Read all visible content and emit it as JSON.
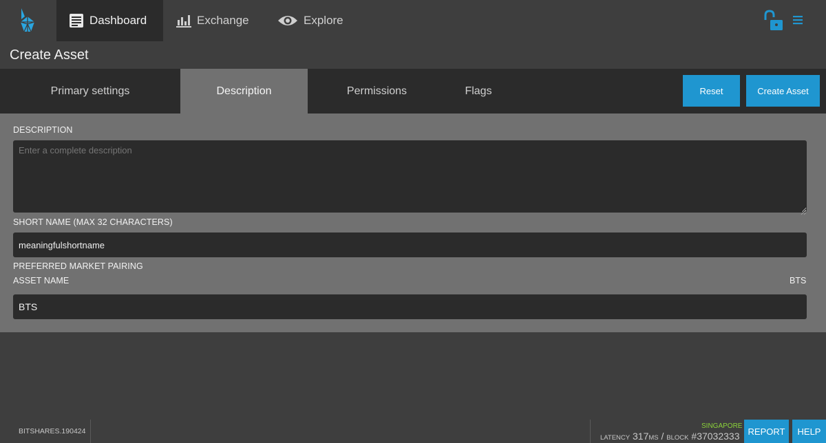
{
  "nav": {
    "items": [
      {
        "label": "Dashboard",
        "icon": "dashboard-icon",
        "active": true
      },
      {
        "label": "Exchange",
        "icon": "bar-chart-icon",
        "active": false
      },
      {
        "label": "Explore",
        "icon": "eye-icon",
        "active": false
      }
    ],
    "right_icons": [
      "unlock-icon",
      "hamburger-menu-icon"
    ]
  },
  "page": {
    "title": "Create Asset"
  },
  "tabs": [
    {
      "label": "Primary settings",
      "active": false
    },
    {
      "label": "Description",
      "active": true
    },
    {
      "label": "Permissions",
      "active": false
    },
    {
      "label": "Flags",
      "active": false
    }
  ],
  "actions": {
    "reset_label": "Reset",
    "create_label": "Create Asset"
  },
  "form": {
    "description_label": "DESCRIPTION",
    "description_placeholder": "Enter a complete description",
    "short_name_label": "SHORT NAME (MAX 32 CHARACTERS)",
    "short_name_value": "meaningfulshortname",
    "preferred_market_label": "PREFERRED MARKET PAIRING",
    "asset_name_label": "ASSET NAME",
    "asset_name_right": "BTS",
    "asset_name_value": "BTS"
  },
  "footer": {
    "version": "BITSHARES.190424",
    "location": "SINGAPORE",
    "latency_label": "Latency",
    "latency_value": "317",
    "latency_unit": "ms",
    "block_label": "Block",
    "block_value": "#37032333",
    "report_label": "REPORT",
    "help_label": "HELP"
  },
  "colors": {
    "accent": "#1f96d0",
    "background": "#3e3e3e",
    "panel": "#717171",
    "dark": "#2b2b2b",
    "status_green": "#8bd33a"
  }
}
